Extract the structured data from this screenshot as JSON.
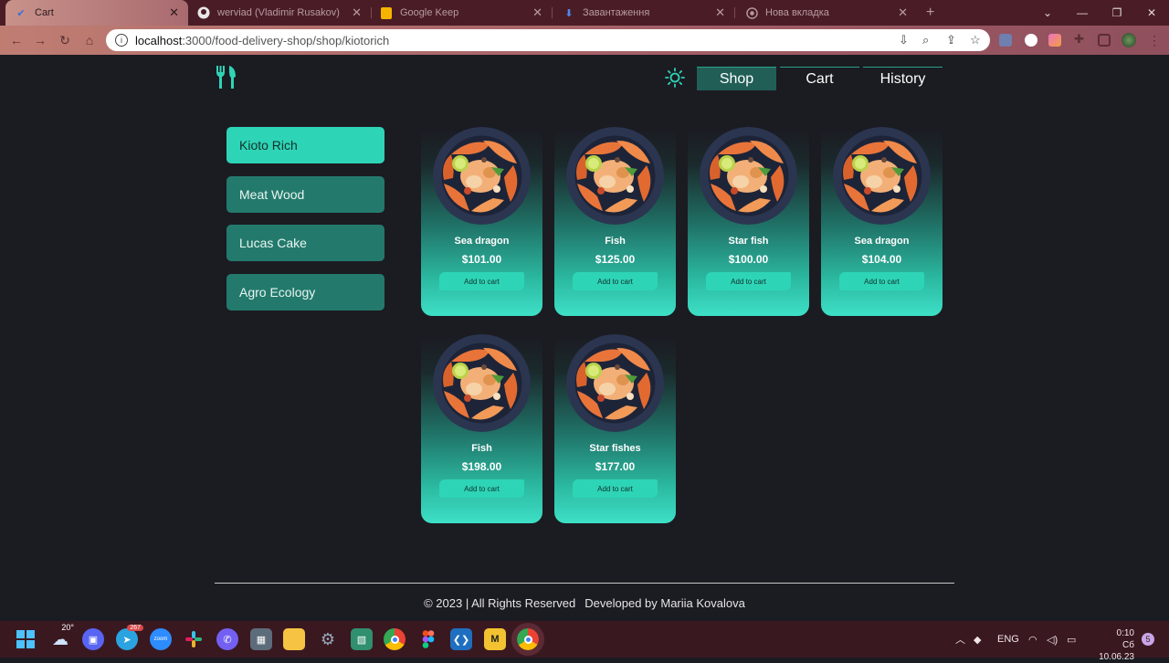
{
  "browser": {
    "tabs": [
      {
        "title": "Cart",
        "icon": "check-icon"
      },
      {
        "title": "werviad (Vladimir Rusakov)",
        "icon": "github-icon"
      },
      {
        "title": "Google Keep",
        "icon": "keep-icon"
      },
      {
        "title": "Завантаження",
        "icon": "download-icon"
      },
      {
        "title": "Нова вкладка",
        "icon": "chrome-icon"
      }
    ],
    "url_host": "localhost",
    "url_path": ":3000/food-delivery-shop/shop/kiotorich"
  },
  "header": {
    "nav": [
      {
        "label": "Shop",
        "active": true
      },
      {
        "label": "Cart",
        "active": false
      },
      {
        "label": "History",
        "active": false
      }
    ]
  },
  "shops": [
    {
      "label": "Kioto Rich",
      "active": true
    },
    {
      "label": "Meat Wood",
      "active": false
    },
    {
      "label": "Lucas Cake",
      "active": false
    },
    {
      "label": "Agro Ecology",
      "active": false
    }
  ],
  "products": [
    {
      "name": "Sea dragon",
      "price": "$101.00",
      "button": "Add to cart"
    },
    {
      "name": "Fish",
      "price": "$125.00",
      "button": "Add to cart"
    },
    {
      "name": "Star fish",
      "price": "$100.00",
      "button": "Add to cart"
    },
    {
      "name": "Sea dragon",
      "price": "$104.00",
      "button": "Add to cart"
    },
    {
      "name": "Fish",
      "price": "$198.00",
      "button": "Add to cart"
    },
    {
      "name": "Star fishes",
      "price": "$177.00",
      "button": "Add to cart"
    }
  ],
  "footer": {
    "copyright": "© 2023 | All Rights Reserved",
    "developer": "Developed by Mariia Kovalova"
  },
  "taskbar": {
    "weather": "20°",
    "telegram_badge": "267",
    "language": "ENG",
    "time": "0:10",
    "date": "Сб 10.06.23",
    "notification_count": "5"
  },
  "colors": {
    "accent": "#2ed4b6",
    "accent_dark": "#237a6c",
    "background": "#1b1b22"
  }
}
